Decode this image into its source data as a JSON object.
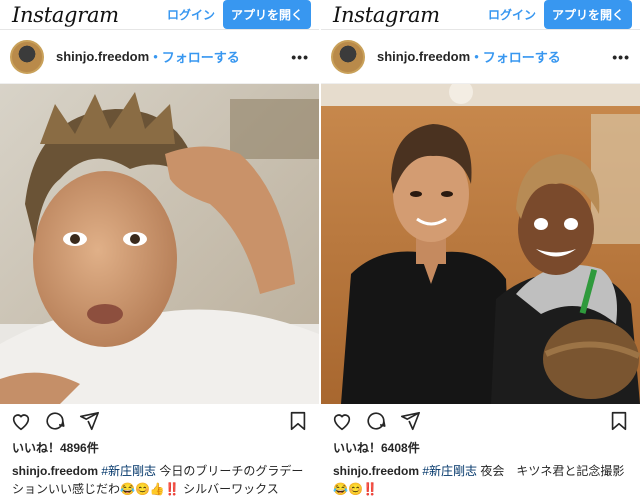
{
  "header": {
    "logo": "Instagram",
    "login_label": "ログイン",
    "open_app_label": "アプリを開く"
  },
  "posts": [
    {
      "username": "shinjo.freedom",
      "separator": "•",
      "follow_label": "フォローする",
      "more_label": "•••",
      "likes": "いいね！4896件",
      "caption": {
        "username": "shinjo.freedom",
        "hashtag": "#新庄剛志",
        "text": "今日のブリーチのグラデーションいい感じだわ😂😊👍‼️ シルバーワックス"
      }
    },
    {
      "username": "shinjo.freedom",
      "separator": "•",
      "follow_label": "フォローする",
      "more_label": "•••",
      "likes": "いいね！6408件",
      "caption": {
        "username": "shinjo.freedom",
        "hashtag": "#新庄剛志",
        "text": "夜会　キツネ君と記念撮影😂😊‼️"
      }
    }
  ],
  "icons": [
    "heart-icon",
    "comment-icon",
    "share-icon",
    "bookmark-icon"
  ],
  "colors": {
    "accent": "#3897f0",
    "text": "#262626"
  }
}
